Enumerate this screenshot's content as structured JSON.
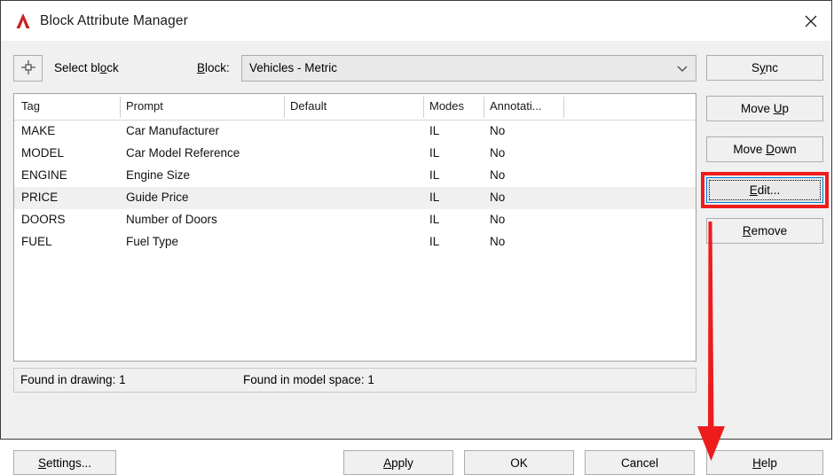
{
  "window": {
    "title": "Block Attribute Manager",
    "logo_icon": "autocad-a-logo",
    "close_icon": "close-icon"
  },
  "toolbar": {
    "select_block_icon": "pick-point-crosshair-icon",
    "select_block_label": "Select block",
    "block_label": "Block:",
    "block_value": "Vehicles - Metric",
    "dropdown_icon": "chevron-down-icon"
  },
  "table": {
    "columns": [
      "Tag",
      "Prompt",
      "Default",
      "Modes",
      "Annotati..."
    ],
    "rows": [
      {
        "tag": "MAKE",
        "prompt": "Car Manufacturer",
        "default": "",
        "modes": "IL",
        "annotative": "No",
        "selected": false
      },
      {
        "tag": "MODEL",
        "prompt": "Car Model Reference",
        "default": "",
        "modes": "IL",
        "annotative": "No",
        "selected": false
      },
      {
        "tag": "ENGINE",
        "prompt": "Engine Size",
        "default": "",
        "modes": "IL",
        "annotative": "No",
        "selected": false
      },
      {
        "tag": "PRICE",
        "prompt": "Guide Price",
        "default": "",
        "modes": "IL",
        "annotative": "No",
        "selected": true
      },
      {
        "tag": "DOORS",
        "prompt": "Number of Doors",
        "default": "",
        "modes": "IL",
        "annotative": "No",
        "selected": false
      },
      {
        "tag": "FUEL",
        "prompt": "Fuel Type",
        "default": "",
        "modes": "IL",
        "annotative": "No",
        "selected": false
      }
    ]
  },
  "status": {
    "found_in_drawing": "Found in drawing: 1",
    "found_in_model_space": "Found in model space: 1"
  },
  "side_buttons": {
    "sync": {
      "pre": "S",
      "mnemonic": "y",
      "post": "nc"
    },
    "move_up": {
      "pre": "Move ",
      "mnemonic": "U",
      "post": "p"
    },
    "move_down": {
      "pre": "Move ",
      "mnemonic": "D",
      "post": "own"
    },
    "edit": {
      "pre": "",
      "mnemonic": "E",
      "post": "dit..."
    },
    "remove": {
      "pre": "",
      "mnemonic": "R",
      "post": "emove"
    }
  },
  "bottom_buttons": {
    "settings": {
      "pre": "",
      "mnemonic": "S",
      "post": "ettings..."
    },
    "apply": {
      "pre": "",
      "mnemonic": "A",
      "post": "pply"
    },
    "ok": {
      "pre": "OK",
      "mnemonic": "",
      "post": ""
    },
    "cancel": {
      "pre": "Cancel",
      "mnemonic": "",
      "post": ""
    },
    "help": {
      "pre": "",
      "mnemonic": "H",
      "post": "elp"
    }
  },
  "annotation": {
    "highlight_color": "#ee1c1c",
    "arrow_color": "#ee1c1c",
    "target": "edit-button"
  },
  "colors": {
    "dialog_bg": "#f0f0f0",
    "list_bg": "#ffffff",
    "selected_row": "#f0f0f0",
    "button_border": "#adadad",
    "focus_border": "#0078d7",
    "logo_red": "#cc2222"
  },
  "layout": {
    "column_x": [
      22,
      140,
      325,
      482,
      550
    ],
    "divider_x": [
      133,
      318,
      475,
      543,
      633
    ]
  }
}
